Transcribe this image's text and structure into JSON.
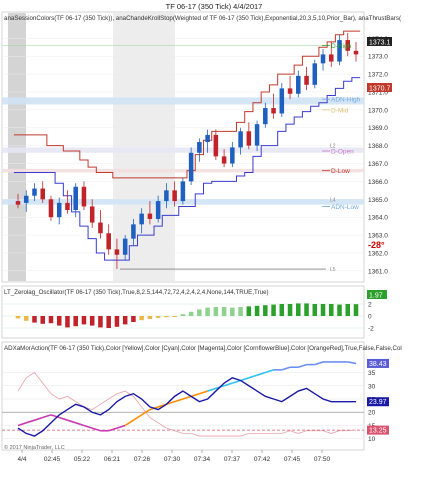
{
  "window_title": "TF 06-17 (350 Tick)  4/4/2017",
  "copyright": "© 2017 NinjaTrader, LLC",
  "panels": {
    "price": {
      "indicator_label": "anaSessionColors(TF 06-17 (350 Tick)), anaChandeKrollStop(Weighted of TF 06-17 (350 Tick),Exponential,20,3,5,10,Prior_Bar),  anaThrustBars(",
      "ticks": [
        "1374.0",
        "1373.0",
        "1372.0",
        "1371.0",
        "1370.0",
        "1369.0",
        "1368.0",
        "1367.0",
        "1366.0",
        "1365.0",
        "1364.0",
        "1363.0",
        "1362.0",
        "1361.0"
      ],
      "current_price": "1373.1",
      "current_price_color": "#ffffff",
      "marker_price": "1370.7",
      "level_labels": [
        {
          "text": "D-High",
          "color": "#2ca02c",
          "price": 1373.6
        },
        {
          "text": "ADN-High",
          "color": "#6fa8dc",
          "price": 1370.6
        },
        {
          "text": "D-Mid",
          "color": "#e0c070",
          "price": 1370.0
        },
        {
          "text": "D-Open",
          "color": "#c878c8",
          "price": 1367.7
        },
        {
          "text": "D-Low",
          "color": "#c0392b",
          "price": 1366.6
        },
        {
          "text": "ADN-Low",
          "color": "#6fa8dc",
          "price": 1364.6
        }
      ],
      "small_marks": [
        "L2",
        "L4",
        "L5"
      ],
      "angle_label": "-28°",
      "angle_color": "#cc0000"
    },
    "oscillator": {
      "indicator_label": "LT_Zerolag_Oscillator(TF 06-17 (350 Tick),True,8,2.5,144,72,72,4,2,4,2,4,None,144,TRUE,True)",
      "ticks": [
        "2",
        "0",
        "-2"
      ],
      "current_value": "1.97",
      "value_color": "#2ca02c"
    },
    "adx": {
      "indicator_label": "ADXaMorAction(TF 06-17 (350 Tick),Color [Yellow],Color [Cyan],Color [Magenta],Color [CornflowerBlue],Color [OrangeRed],True,False,False,Col",
      "ticks": [
        "35",
        "30",
        "25",
        "20",
        "15",
        "10"
      ],
      "values": [
        {
          "text": "38.43",
          "color": "#5b5bd6"
        },
        {
          "text": "23.97",
          "color": "#1a1aa6"
        },
        {
          "text": "13.25",
          "color": "#d9536f"
        }
      ]
    }
  },
  "time_axis": [
    "4/4",
    "02:45",
    "05:22",
    "06:21",
    "07:26",
    "07:30",
    "07:34",
    "07:37",
    "07:42",
    "07:45",
    "07:50"
  ],
  "colors": {
    "up_bar": "#1f5fbf",
    "down_bar": "#c0232a",
    "chandekroll_stop": "#c0392b",
    "adx_line": "#1a1aa6",
    "session_shade": "#dcdcdc"
  },
  "chart_data": {
    "type": "candlestick",
    "price_range": [
      1360.6,
      1374.8
    ],
    "bars": [
      {
        "o": 1364.9,
        "h": 1365.3,
        "l": 1364.5,
        "c": 1364.7
      },
      {
        "o": 1364.8,
        "h": 1365.5,
        "l": 1364.3,
        "c": 1365.2
      },
      {
        "o": 1365.2,
        "h": 1365.9,
        "l": 1364.9,
        "c": 1365.6
      },
      {
        "o": 1365.6,
        "h": 1366.0,
        "l": 1364.8,
        "c": 1365.0
      },
      {
        "o": 1365.0,
        "h": 1365.2,
        "l": 1363.8,
        "c": 1364.0
      },
      {
        "o": 1364.0,
        "h": 1365.1,
        "l": 1363.6,
        "c": 1364.8
      },
      {
        "o": 1364.8,
        "h": 1365.5,
        "l": 1364.2,
        "c": 1364.4
      },
      {
        "o": 1364.4,
        "h": 1365.9,
        "l": 1364.0,
        "c": 1365.7
      },
      {
        "o": 1365.7,
        "h": 1366.0,
        "l": 1364.4,
        "c": 1364.6
      },
      {
        "o": 1364.6,
        "h": 1365.0,
        "l": 1363.4,
        "c": 1363.7
      },
      {
        "o": 1363.7,
        "h": 1364.4,
        "l": 1362.8,
        "c": 1363.1
      },
      {
        "o": 1363.1,
        "h": 1363.6,
        "l": 1361.9,
        "c": 1362.2
      },
      {
        "o": 1362.2,
        "h": 1362.8,
        "l": 1361.1,
        "c": 1361.9
      },
      {
        "o": 1361.9,
        "h": 1363.0,
        "l": 1361.6,
        "c": 1362.8
      },
      {
        "o": 1362.8,
        "h": 1363.9,
        "l": 1362.4,
        "c": 1363.6
      },
      {
        "o": 1363.6,
        "h": 1364.5,
        "l": 1363.1,
        "c": 1364.2
      },
      {
        "o": 1364.2,
        "h": 1364.9,
        "l": 1363.6,
        "c": 1363.9
      },
      {
        "o": 1363.9,
        "h": 1365.2,
        "l": 1363.7,
        "c": 1364.9
      },
      {
        "o": 1364.9,
        "h": 1365.9,
        "l": 1364.5,
        "c": 1365.5
      },
      {
        "o": 1365.5,
        "h": 1366.0,
        "l": 1364.6,
        "c": 1364.9
      },
      {
        "o": 1364.9,
        "h": 1366.2,
        "l": 1364.7,
        "c": 1366.0
      },
      {
        "o": 1366.0,
        "h": 1367.9,
        "l": 1365.8,
        "c": 1367.6
      },
      {
        "o": 1367.6,
        "h": 1368.4,
        "l": 1367.1,
        "c": 1368.2
      },
      {
        "o": 1368.2,
        "h": 1368.9,
        "l": 1367.6,
        "c": 1368.6
      },
      {
        "o": 1368.6,
        "h": 1368.9,
        "l": 1367.2,
        "c": 1367.4
      },
      {
        "o": 1367.4,
        "h": 1367.8,
        "l": 1366.8,
        "c": 1367.0
      },
      {
        "o": 1367.0,
        "h": 1368.2,
        "l": 1366.8,
        "c": 1367.9
      },
      {
        "o": 1367.9,
        "h": 1369.0,
        "l": 1367.5,
        "c": 1368.8
      },
      {
        "o": 1368.8,
        "h": 1369.3,
        "l": 1367.8,
        "c": 1368.0
      },
      {
        "o": 1368.0,
        "h": 1369.4,
        "l": 1367.7,
        "c": 1369.2
      },
      {
        "o": 1369.2,
        "h": 1370.4,
        "l": 1369.0,
        "c": 1370.1
      },
      {
        "o": 1370.1,
        "h": 1370.9,
        "l": 1369.5,
        "c": 1369.8
      },
      {
        "o": 1369.8,
        "h": 1371.5,
        "l": 1369.6,
        "c": 1371.2
      },
      {
        "o": 1371.2,
        "h": 1371.9,
        "l": 1370.6,
        "c": 1370.9
      },
      {
        "o": 1370.9,
        "h": 1372.2,
        "l": 1370.7,
        "c": 1371.9
      },
      {
        "o": 1371.9,
        "h": 1372.4,
        "l": 1371.1,
        "c": 1371.4
      },
      {
        "o": 1371.4,
        "h": 1372.8,
        "l": 1371.2,
        "c": 1372.6
      },
      {
        "o": 1372.6,
        "h": 1373.4,
        "l": 1372.2,
        "c": 1373.1
      },
      {
        "o": 1373.1,
        "h": 1373.8,
        "l": 1372.4,
        "c": 1372.7
      },
      {
        "o": 1372.7,
        "h": 1374.2,
        "l": 1372.5,
        "c": 1373.9
      },
      {
        "o": 1373.9,
        "h": 1374.3,
        "l": 1373.0,
        "c": 1373.3
      },
      {
        "o": 1373.3,
        "h": 1373.8,
        "l": 1372.7,
        "c": 1373.1
      }
    ],
    "stop_upper": [
      1368.6,
      1368.6,
      1368.6,
      1368.6,
      1368.0,
      1368.0,
      1367.7,
      1367.7,
      1367.2,
      1366.8,
      1366.5,
      1366.5,
      1366.2,
      1366.2,
      1366.2,
      1366.2,
      1366.2,
      1366.2,
      1366.2,
      1366.2,
      1366.2,
      1366.6,
      1367.5,
      1368.3,
      1368.8,
      1368.8,
      1368.8,
      1369.3,
      1369.9,
      1370.4,
      1371.0,
      1371.4,
      1372.0,
      1372.0,
      1372.5,
      1373.0,
      1373.0,
      1373.5,
      1373.8,
      1374.2,
      1374.4,
      1374.4
    ],
    "stop_lower": [
      1366.5,
      1366.5,
      1366.5,
      1366.5,
      1366.5,
      1365.9,
      1365.2,
      1364.3,
      1363.5,
      1362.8,
      1362.0,
      1361.6,
      1361.6,
      1361.6,
      1362.4,
      1363.0,
      1363.0,
      1363.5,
      1364.1,
      1364.1,
      1364.6,
      1364.6,
      1365.3,
      1365.9,
      1366.0,
      1366.0,
      1366.0,
      1366.3,
      1366.5,
      1367.4,
      1368.0,
      1368.0,
      1368.8,
      1369.2,
      1369.6,
      1369.9,
      1370.2,
      1370.4,
      1370.8,
      1371.2,
      1371.6,
      1371.8
    ],
    "oscillator": [
      -0.4,
      -0.8,
      -1.1,
      -1.3,
      -1.2,
      -1.6,
      -1.9,
      -1.7,
      -1.4,
      -1.6,
      -1.9,
      -2.0,
      -1.8,
      -1.4,
      -1.0,
      -0.7,
      -0.5,
      -0.3,
      -0.2,
      -0.1,
      0.3,
      0.7,
      1.1,
      1.4,
      1.5,
      1.5,
      1.4,
      1.5,
      1.6,
      1.7,
      1.8,
      1.9,
      2.0,
      2.0,
      2.1,
      2.1,
      2.0,
      2.0,
      2.0,
      1.9,
      2.0,
      1.97
    ],
    "adx": [
      14,
      12,
      11,
      13,
      16,
      19,
      21,
      23,
      22,
      20,
      19,
      21,
      24,
      26,
      27,
      25,
      22,
      21,
      23,
      26,
      28,
      26,
      24,
      25,
      28,
      31,
      33,
      32,
      30,
      28,
      26,
      25,
      24,
      26,
      28,
      29,
      27,
      25,
      24,
      24,
      24,
      23.97
    ],
    "di_plus": [
      15,
      16,
      17,
      18,
      19,
      18,
      17,
      16,
      15,
      14,
      13,
      13,
      14,
      15,
      17,
      19,
      21,
      22,
      23,
      24,
      25,
      26,
      27,
      28,
      29,
      30,
      31,
      32,
      33,
      34,
      35,
      36,
      36,
      37,
      37,
      38,
      38,
      39,
      39,
      39,
      39,
      38.43
    ],
    "di_minus": [
      28,
      33,
      35,
      31,
      27,
      25,
      26,
      24,
      22,
      21,
      23,
      25,
      27,
      28,
      26,
      22,
      18,
      16,
      14,
      13,
      12,
      12,
      11,
      11,
      11,
      11,
      11,
      11,
      12,
      12,
      12,
      12,
      12,
      13,
      12,
      13,
      13,
      13,
      12,
      13,
      13,
      13.25
    ]
  }
}
